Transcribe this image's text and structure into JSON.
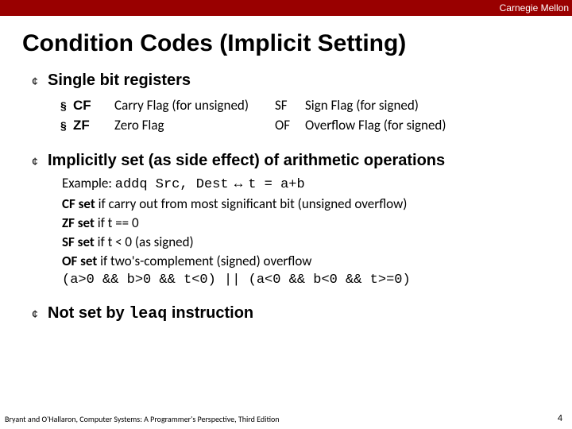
{
  "header": {
    "org": "Carnegie Mellon"
  },
  "title": "Condition Codes (Implicit Setting)",
  "sections": {
    "s1": {
      "heading": "Single bit registers",
      "flags": [
        {
          "sq": "§",
          "code": "CF",
          "desc": "Carry Flag (for unsigned)",
          "code2": "SF",
          "desc2": "Sign Flag (for signed)"
        },
        {
          "sq": "§",
          "code": "ZF",
          "desc": "Zero Flag",
          "code2": "OF",
          "desc2": "Overflow Flag (for signed)"
        }
      ]
    },
    "s2": {
      "heading": "Implicitly set (as side effect) of arithmetic operations",
      "example_label": "Example:",
      "example_code": "addq Src, Dest",
      "example_sym": "↔",
      "example_rhs": "t = a+b",
      "cf_b": "CF set",
      "cf_t": " if carry out from most significant bit (unsigned overflow)",
      "zf_b": "ZF set",
      "zf_t": " if t == 0",
      "sf_b": "SF set",
      "sf_t": " if t < 0 (as signed)",
      "of_b": "OF set",
      "of_t": " if two's-complement (signed) overflow",
      "cond": "(a>0 && b>0 && t<0) || (a<0 && b<0 && t>=0)"
    },
    "s3": {
      "pre": "Not set by ",
      "mono": "leaq",
      "post": " instruction"
    }
  },
  "bullet_glyph": "¢",
  "footer": "Bryant and O'Hallaron, Computer Systems: A Programmer's Perspective, Third Edition",
  "page": "4"
}
